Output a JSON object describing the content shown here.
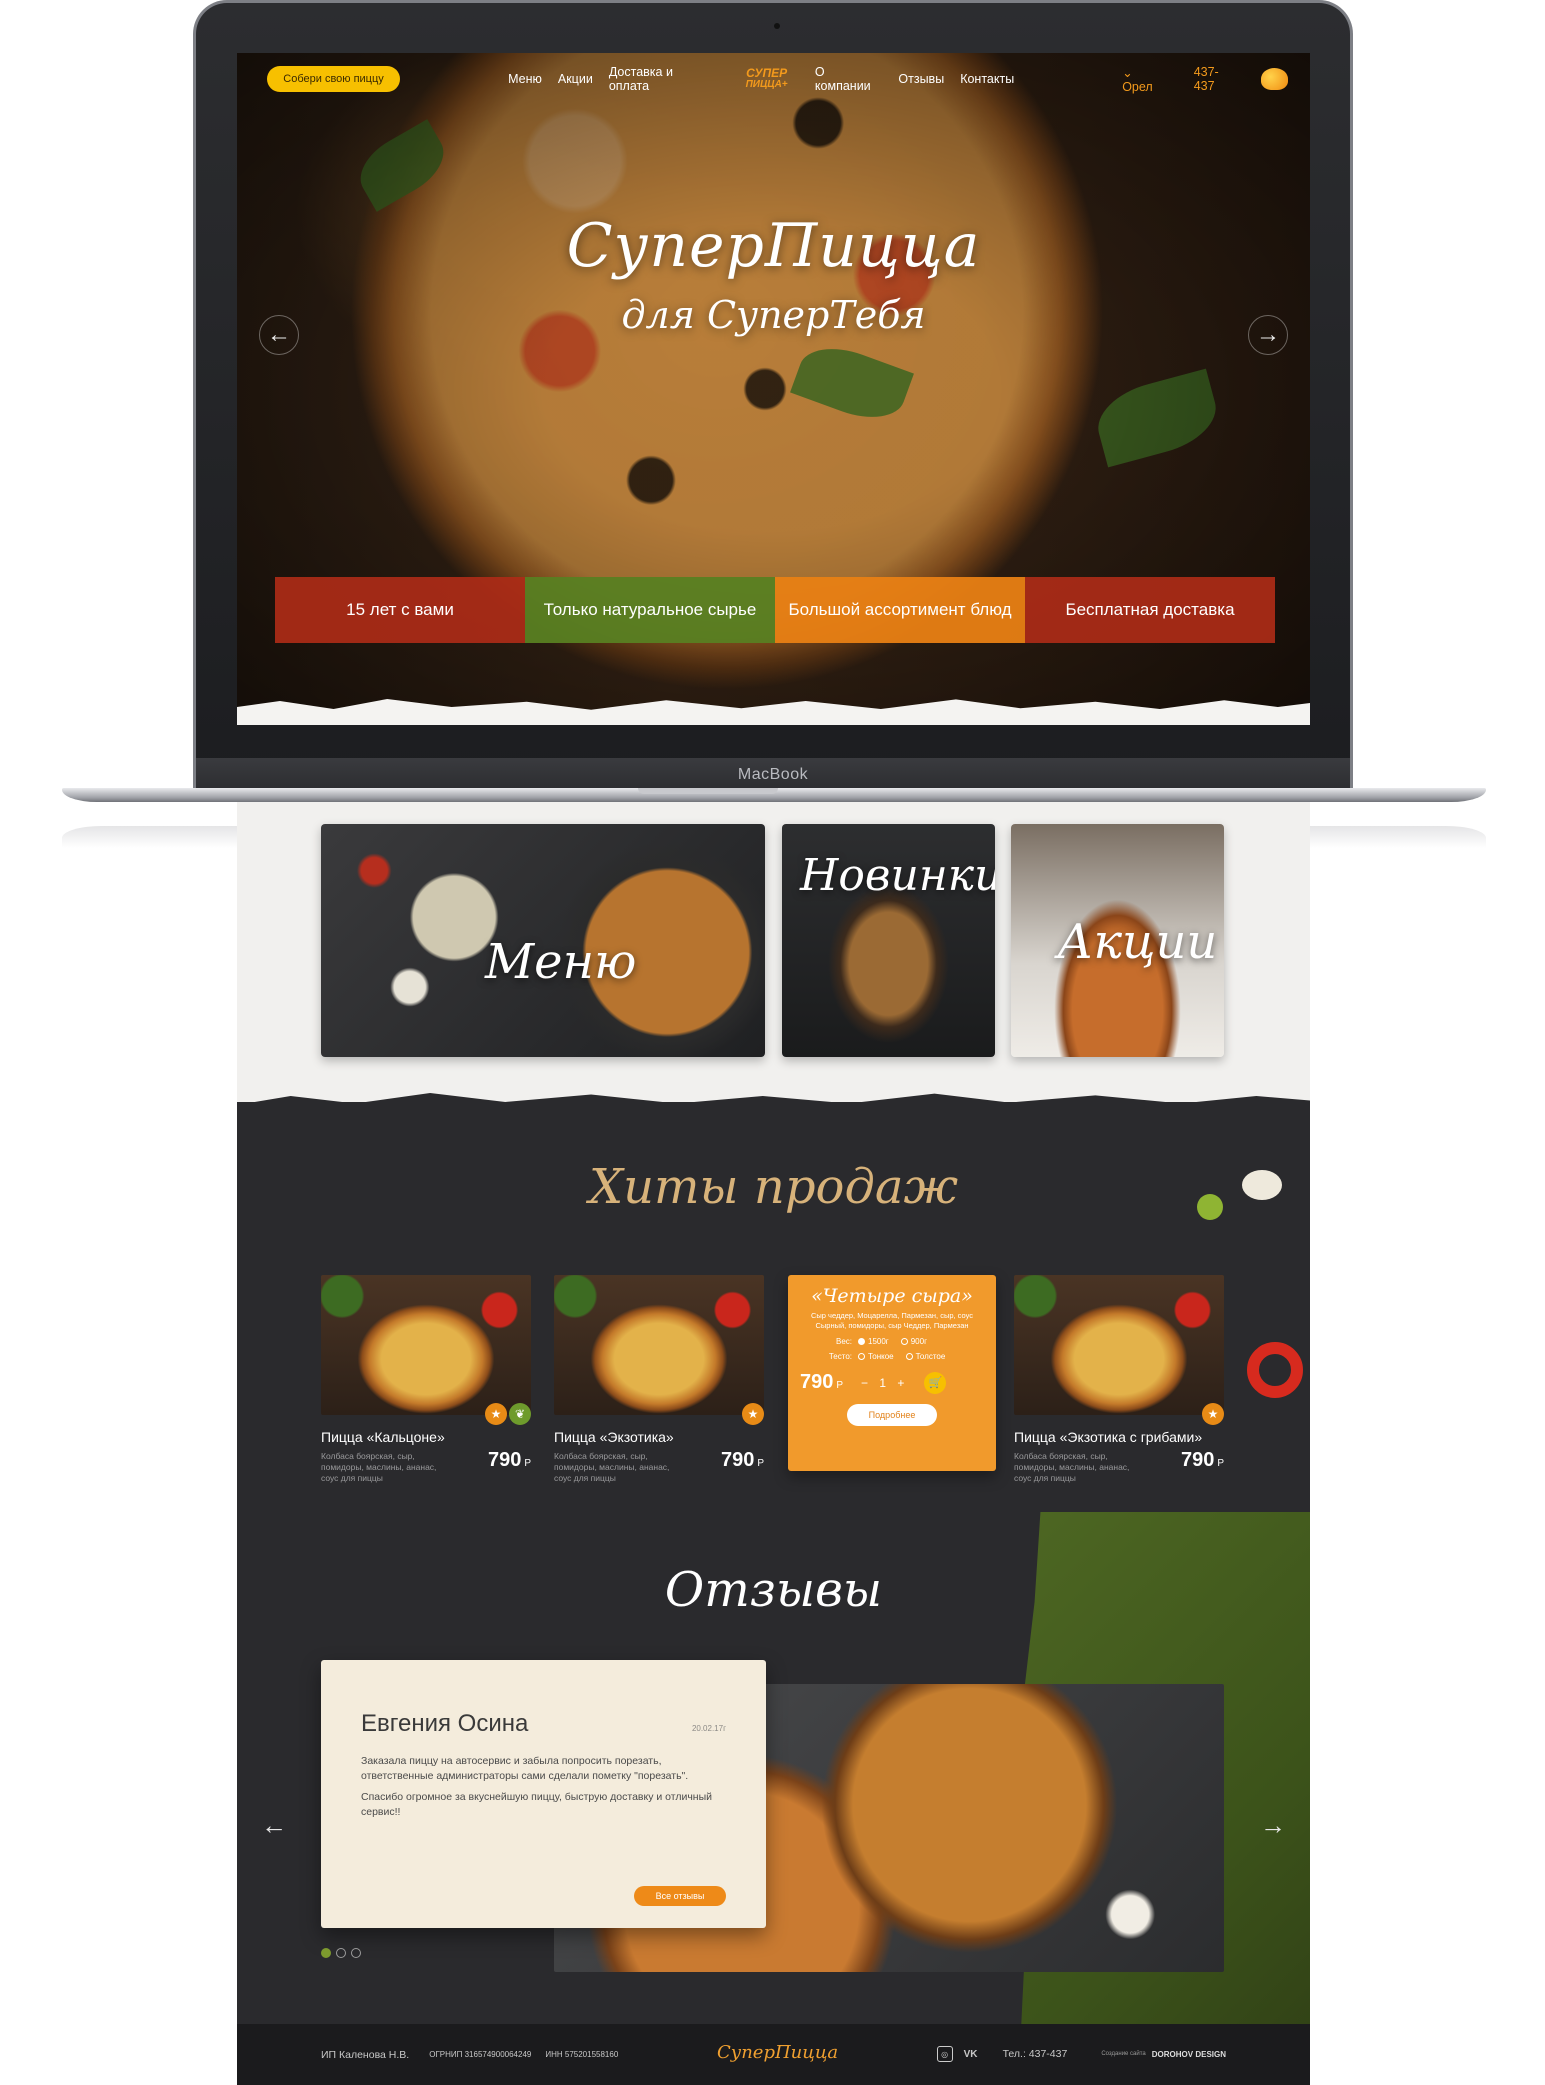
{
  "laptop": {
    "brand": "MacBook"
  },
  "header": {
    "build_button": "Собери свою пиццу",
    "nav": [
      "Меню",
      "Акции",
      "Доставка и оплата",
      "О компании",
      "Отзывы",
      "Контакты"
    ],
    "logo_line1": "СУПЕР",
    "logo_line2": "ПИЦЦА+",
    "city": "Орел",
    "phone": "437-437"
  },
  "hero": {
    "title": "СуперПицца",
    "subtitle": "для СуперТебя",
    "features": [
      "15 лет с вами",
      "Только натуральное сырье",
      "Большой ассортимент блюд",
      "Бесплатная доставка"
    ]
  },
  "categories": {
    "menu": "Меню",
    "new": "Новинки",
    "sale": "Акции"
  },
  "hits": {
    "title": "Хиты продаж",
    "products": [
      {
        "name": "Пицца «Кальцоне»",
        "desc": "Колбаса боярская, сыр, помидоры, маслины, ананас, соус для пиццы",
        "price": "790",
        "currency": "Р"
      },
      {
        "name": "Пицца «Экзотика»",
        "desc": "Колбаса боярская, сыр, помидоры, маслины, ананас, соус для пиццы",
        "price": "790",
        "currency": "Р"
      },
      {
        "name": "Пицца «Экзотика с грибами»",
        "desc": "Колбаса боярская, сыр, помидоры, маслины, ананас, соус для пиццы",
        "price": "790",
        "currency": "Р"
      }
    ],
    "featured": {
      "title": "«Четыре сыра»",
      "desc": "Сыр чеддер, Моцарелла, Пармезан, сыр, соус Сырный, помидоры, сыр Чеддер, Пармезан",
      "weight_label": "Вес:",
      "weight_options": [
        "1500г",
        "900г"
      ],
      "dough_label": "Тесто:",
      "dough_options": [
        "Тонкое",
        "Толстое"
      ],
      "price": "790",
      "currency": "Р",
      "qty": "− 1 +",
      "more": "Подробнее"
    }
  },
  "reviews": {
    "title": "Отзывы",
    "name": "Евгения Осина",
    "date": "20.02.17г",
    "text1": "Заказала пиццу на автосервис и забыла попросить порезать, ответственные администраторы сами сделали пометку \"порезать\".",
    "text2": "Спасибо огромное за вкуснейшую пиццу, быструю доставку и отличный сервис!!",
    "all_button": "Все отзывы"
  },
  "footer": {
    "ip": "ИП Каленова Н.В.",
    "ogrnip": "ОГРНИП 316574900064249",
    "inn": "ИНН 575201558160",
    "logo": "СуперПицца",
    "phone": "Тел.: 437-437",
    "made_by": "Создание сайта",
    "studio": "DOROHOV DESIGN"
  },
  "colors": {
    "accent_orange": "#f19a2c",
    "accent_yellow": "#f7c000",
    "dark_bg": "#2a2a2d",
    "green": "#4f6a22",
    "red": "#ad2b17"
  }
}
